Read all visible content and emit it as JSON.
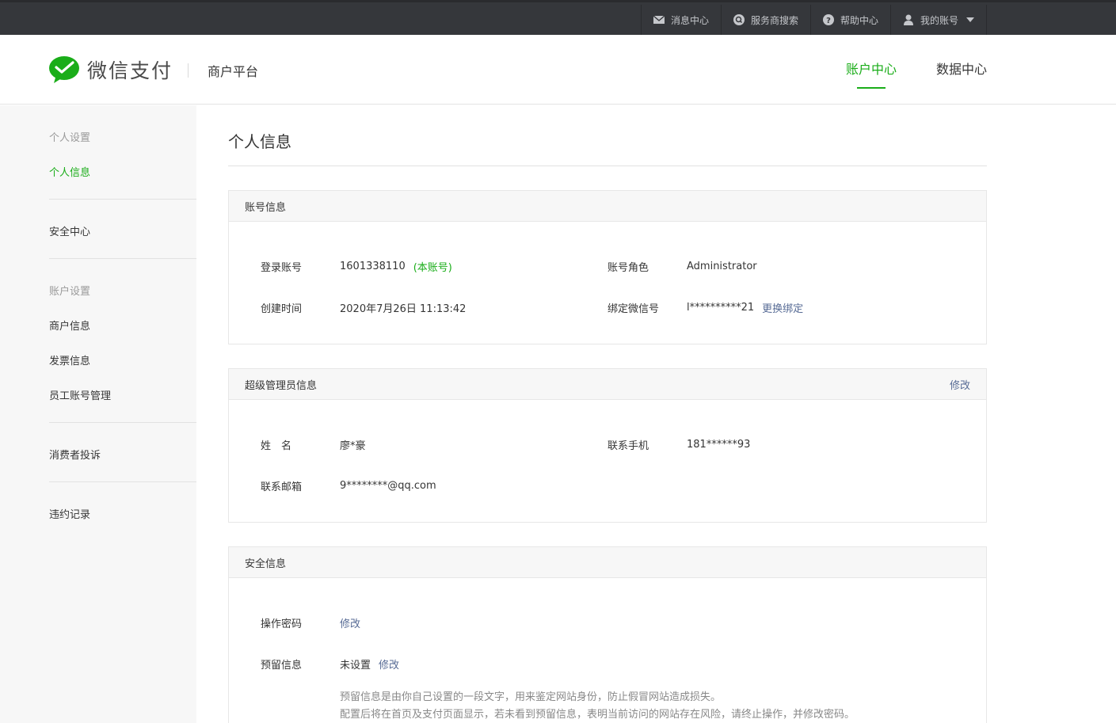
{
  "topbar": {
    "items": [
      {
        "label": "消息中心",
        "icon": "mail-icon"
      },
      {
        "label": "服务商搜索",
        "icon": "search-icon"
      },
      {
        "label": "帮助中心",
        "icon": "help-icon"
      },
      {
        "label": "我的账号",
        "icon": "user-icon"
      }
    ]
  },
  "header": {
    "logo_text": "微信支付",
    "platform": "商户平台",
    "nav": [
      {
        "label": "账户中心",
        "active": true
      },
      {
        "label": "数据中心",
        "active": false
      }
    ]
  },
  "sidebar": {
    "groups": [
      {
        "title": "个人设置",
        "items": [
          "个人信息"
        ]
      },
      {
        "title": "",
        "items": [
          "安全中心"
        ]
      },
      {
        "title": "账户设置",
        "items": [
          "商户信息",
          "发票信息",
          "员工账号管理"
        ]
      },
      {
        "title": "",
        "items": [
          "消费者投诉"
        ]
      },
      {
        "title": "",
        "items": [
          "违约记录"
        ]
      }
    ]
  },
  "main": {
    "title": "个人信息",
    "account": {
      "heading": "账号信息",
      "login_label": "登录账号",
      "login_value": "1601338110",
      "login_tag": "(本账号)",
      "role_label": "账号角色",
      "role_value": "Administrator",
      "created_label": "创建时间",
      "created_value": "2020年7月26日 11:13:42",
      "wechat_label": "绑定微信号",
      "wechat_value": "l**********21",
      "wechat_action": "更换绑定"
    },
    "admin": {
      "heading": "超级管理员信息",
      "edit": "修改",
      "name_label": "姓　名",
      "name_value": "廖*豪",
      "phone_label": "联系手机",
      "phone_value": "181******93",
      "email_label": "联系邮箱",
      "email_value": "9********@qq.com"
    },
    "security": {
      "heading": "安全信息",
      "password_label": "操作密码",
      "password_action": "修改",
      "reserved_label": "预留信息",
      "reserved_value": "未设置",
      "reserved_action": "修改",
      "note_line1": "预留信息是由你自己设置的一段文字，用来鉴定网站身份，防止假冒网站造成损失。",
      "note_line2": "配置后将在首页及支付页面显示，若未看到预留信息，表明当前访问的网站存在风险，请终止操作，并修改密码。"
    }
  },
  "colors": {
    "brand": "#1aad19",
    "link": "#576b95",
    "topbar": "#35373b"
  }
}
